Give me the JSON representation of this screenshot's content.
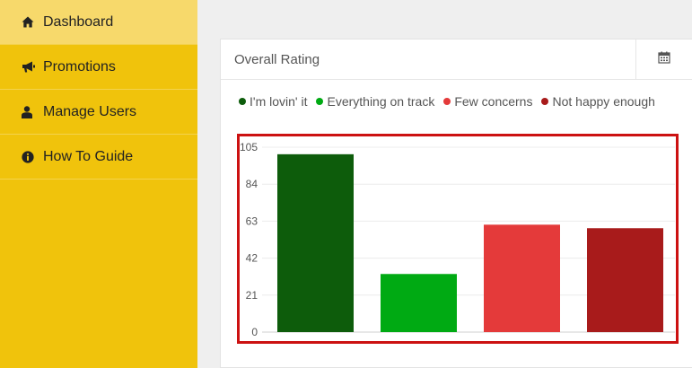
{
  "sidebar": {
    "items": [
      {
        "label": "Dashboard",
        "icon": "home-icon",
        "active": true
      },
      {
        "label": "Promotions",
        "icon": "megaphone-icon",
        "active": false
      },
      {
        "label": "Manage Users",
        "icon": "user-icon",
        "active": false
      },
      {
        "label": "How To Guide",
        "icon": "info-circle-icon",
        "active": false
      }
    ]
  },
  "panel": {
    "title": "Overall Rating",
    "calendar_icon": "calendar-icon"
  },
  "legend": [
    {
      "label": "I'm lovin' it",
      "color": "#0d5c0b"
    },
    {
      "label": "Everything on track",
      "color": "#00aa13"
    },
    {
      "label": "Few concerns",
      "color": "#e43a3a"
    },
    {
      "label": "Not happy enough",
      "color": "#a81b1b"
    }
  ],
  "chart_data": {
    "type": "bar",
    "categories": [
      "I'm lovin' it",
      "Everything on track",
      "Few concerns",
      "Not happy enough"
    ],
    "values": [
      101,
      33,
      61,
      59
    ],
    "colors": [
      "#0d5c0b",
      "#00aa13",
      "#e43a3a",
      "#a81b1b"
    ],
    "yticks": [
      0,
      21,
      42,
      63,
      84,
      105
    ],
    "ylim": [
      0,
      105
    ],
    "grid": true
  }
}
